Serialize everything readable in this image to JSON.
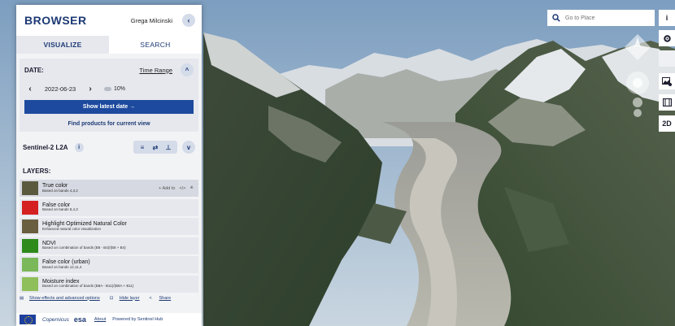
{
  "header": {
    "brand": "BROWSER",
    "user": "Grega Milcinski",
    "collapse_icon": "chevron-left-icon"
  },
  "tabs": [
    {
      "label": "VISUALIZE",
      "active": true
    },
    {
      "label": "SEARCH",
      "active": false
    }
  ],
  "date_panel": {
    "label": "DATE:",
    "time_range": "Time Range",
    "date": "2022-06-23",
    "cloud_coverage": "10%",
    "show_latest": "Show latest date",
    "find_products": "Find products for current view"
  },
  "collection": {
    "name": "Sentinel-2 L2A",
    "info": "i"
  },
  "layers_label": "LAYERS:",
  "layers": [
    {
      "title": "True color",
      "subtitle": "Based on bands 4,3,2",
      "selected": true,
      "add_to": "Add to",
      "thumb_color": "#5a5a3e"
    },
    {
      "title": "False color",
      "subtitle": "Based on bands 8,4,3",
      "selected": false,
      "thumb_color": "#d42020"
    },
    {
      "title": "Highlight Optimized Natural Color",
      "subtitle": "Enhanced natural color visualization",
      "selected": false,
      "thumb_color": "#6a5e40"
    },
    {
      "title": "NDVI",
      "subtitle": "Based on combination of bands (B8 - B4)/(B8 + B4)",
      "selected": false,
      "thumb_color": "#2f8a1c"
    },
    {
      "title": "False color (urban)",
      "subtitle": "Based on bands 12,11,4",
      "selected": false,
      "thumb_color": "#7ab85a"
    },
    {
      "title": "Moisture index",
      "subtitle": "Based on combination of bands (B8A - B11)/(B8A + B11)",
      "selected": false,
      "thumb_color": "#8fbf5a"
    }
  ],
  "effects": {
    "show_effects": "Show effects and advanced options",
    "hide_layer": "Hide layer",
    "share": "Share"
  },
  "footer": {
    "copernicus": "Copernicus",
    "esa": "esa",
    "about": "About",
    "powered_by": "Powered by Sentinel Hub"
  },
  "map_controls": {
    "search_placeholder": "Go to Place",
    "info": "i",
    "mode_2d": "2D"
  }
}
